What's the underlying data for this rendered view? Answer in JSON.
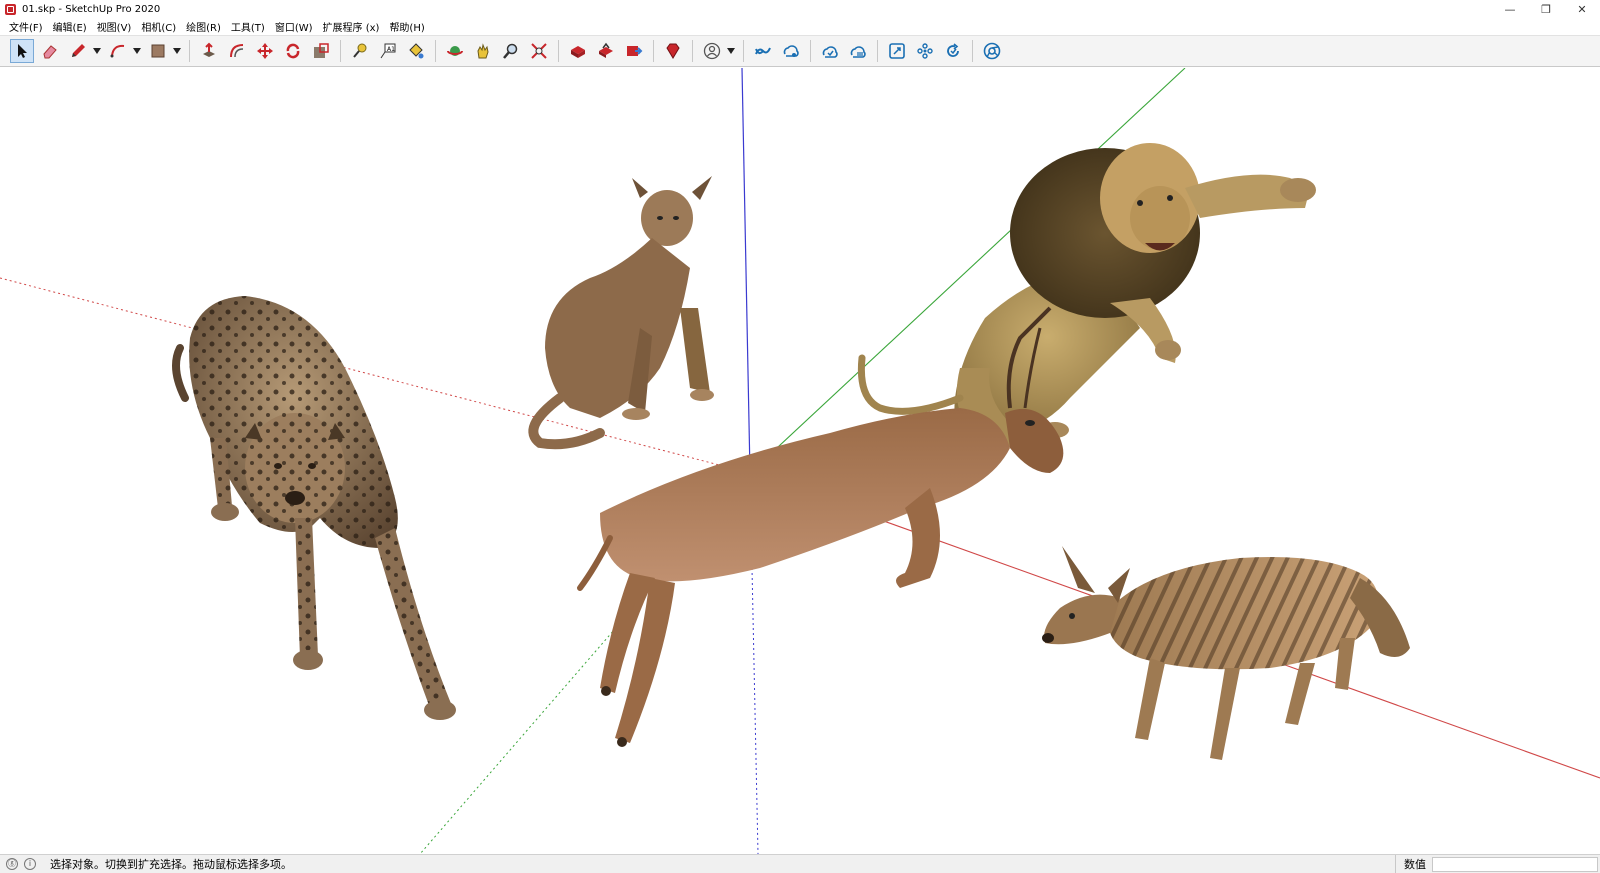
{
  "window": {
    "title": "01.skp - SketchUp Pro 2020",
    "controls": {
      "minimize": "—",
      "restore": "❐",
      "close": "✕"
    }
  },
  "menu": [
    "文件(F)",
    "编辑(E)",
    "视图(V)",
    "相机(C)",
    "绘图(R)",
    "工具(T)",
    "窗口(W)",
    "扩展程序 (x)",
    "帮助(H)"
  ],
  "toolbar": {
    "tools": [
      "select-tool-icon",
      "eraser-tool-icon",
      "pencil-line-tool-icon",
      "arc-tool-icon",
      "shape-tool-icon",
      "push-pull-tool-icon",
      "offset-tool-icon",
      "move-tool-icon",
      "rotate-tool-icon",
      "scale-tool-icon",
      "tape-measure-icon",
      "text-tool-icon",
      "paint-bucket-icon",
      "orbit-tool-icon",
      "pan-tool-icon",
      "zoom-tool-icon",
      "zoom-extents-icon",
      "warehouse-icon",
      "share-model-icon",
      "extension-warehouse-icon",
      "ruby-extension-icon",
      "account-icon",
      "trimble-connect-icon",
      "trimble-connect-share-icon",
      "cloud-sync-icon",
      "cloud-upload-icon",
      "layout-icon",
      "style-builder-icon",
      "update-icon",
      "chrome-icon"
    ],
    "accent": "#c8262b"
  },
  "viewport": {
    "models": [
      "caracal-model",
      "lion-model",
      "cheetah-model",
      "gazelle-model",
      "hyena-model"
    ],
    "axis_colors": {
      "red": "#d04848",
      "green": "#3aa63a",
      "blue": "#3a3ad0"
    }
  },
  "status": {
    "info_icon": "info-icon",
    "geo_icon": "geo-location-icon",
    "message": "选择对象。切换到扩充选择。拖动鼠标选择多项。",
    "measurements_label": "数值",
    "measurements_value": ""
  }
}
